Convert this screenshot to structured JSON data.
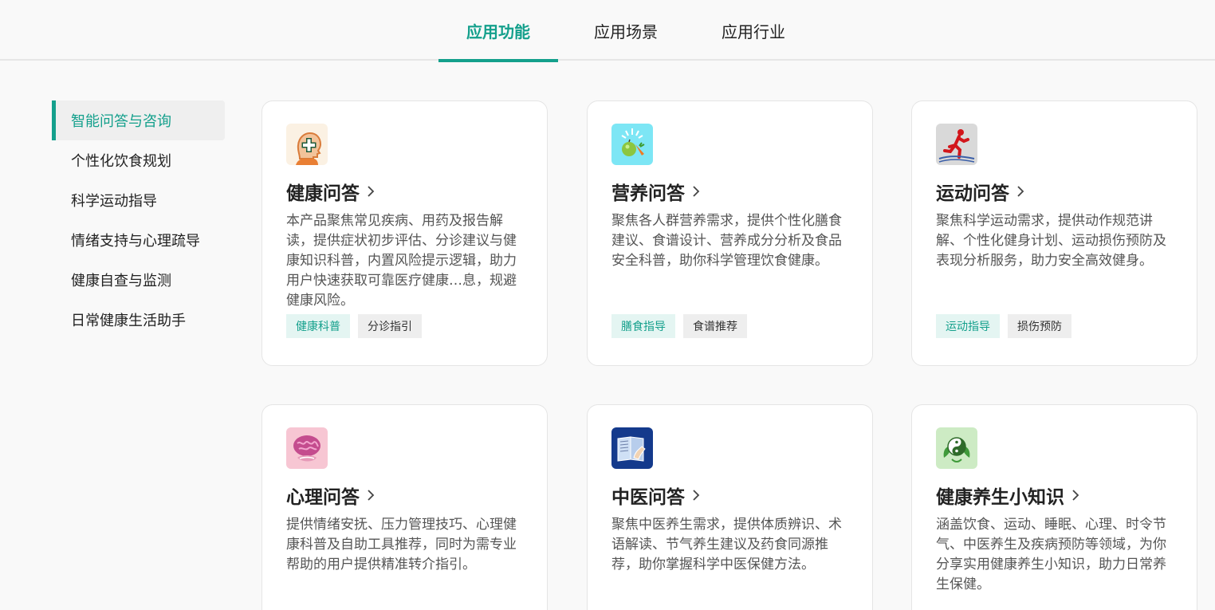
{
  "tabs": [
    {
      "label": "应用功能",
      "active": true
    },
    {
      "label": "应用场景",
      "active": false
    },
    {
      "label": "应用行业",
      "active": false
    }
  ],
  "sidebar": {
    "items": [
      {
        "label": "智能问答与咨询",
        "active": true
      },
      {
        "label": "个性化饮食规划",
        "active": false
      },
      {
        "label": "科学运动指导",
        "active": false
      },
      {
        "label": "情绪支持与心理疏导",
        "active": false
      },
      {
        "label": "健康自查与监测",
        "active": false
      },
      {
        "label": "日常健康生活助手",
        "active": false
      }
    ]
  },
  "cards": [
    {
      "icon": "health-head-icon",
      "title": "健康问答",
      "desc": "本产品聚焦常见疾病、用药及报告解读，提供症状初步评估、分诊建议与健康知识科普，内置风险提示逻辑，助力用户快速获取可靠医疗健康…息，规避健康风险。",
      "tags": [
        "健康科普",
        "分诊指引"
      ]
    },
    {
      "icon": "nutrition-fruit-icon",
      "title": "营养问答",
      "desc": "聚焦各人群营养需求，提供个性化膳食建议、食谱设计、营养成分分析及食品安全科普，助你科学管理饮食健康。",
      "tags": [
        "膳食指导",
        "食谱推荐"
      ]
    },
    {
      "icon": "running-person-icon",
      "title": "运动问答",
      "desc": "聚焦科学运动需求，提供动作规范讲解、个性化健身计划、运动损伤预防及表现分析服务，助力安全高效健身。",
      "tags": [
        "运动指导",
        "损伤预防"
      ]
    },
    {
      "icon": "brain-icon",
      "title": "心理问答",
      "desc": "提供情绪安抚、压力管理技巧、心理健康科普及自助工具推荐，同时为需专业帮助的用户提供精准转介指引。",
      "tags": []
    },
    {
      "icon": "tcm-book-icon",
      "title": "中医问答",
      "desc": "聚焦中医养生需求，提供体质辨识、术语解读、节气养生建议及药食同源推荐，助你掌握科学中医保健方法。",
      "tags": []
    },
    {
      "icon": "yin-yang-leaf-icon",
      "title": "健康养生小知识",
      "desc": "涵盖饮食、运动、睡眠、心理、时令节气、中医养生及疾病预防等领域，为你分享实用健康养生小知识，助力日常养生保健。",
      "tags": []
    }
  ],
  "colors": {
    "accent": "#14a08c",
    "tag_green_bg": "#e4f5f2",
    "tag_gray_bg": "#eeeeee"
  }
}
